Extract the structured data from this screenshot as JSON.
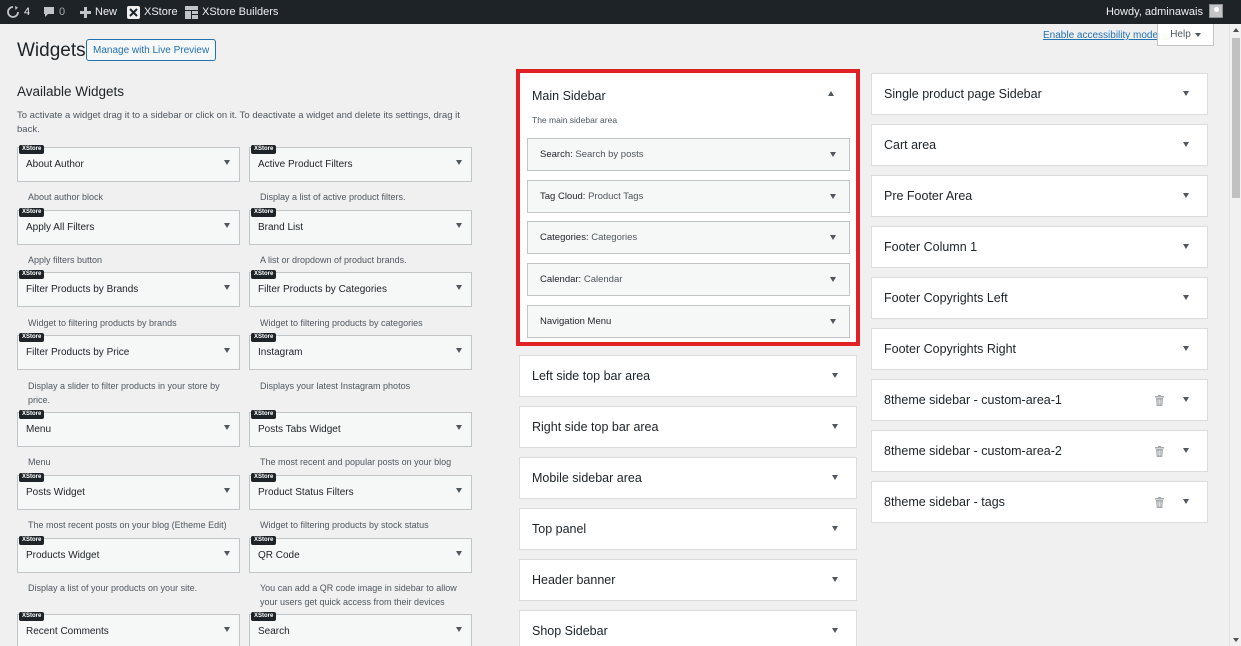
{
  "adminbar": {
    "updates_count": "4",
    "comments_count": "0",
    "new_label": "New",
    "xstore_label": "XStore",
    "builders_label": "XStore Builders",
    "howdy": "Howdy, adminawais"
  },
  "header": {
    "title": "Widgets",
    "live_preview_label": "Manage with Live Preview",
    "accessibility_link": "Enable accessibility mode",
    "help_label": "Help"
  },
  "available": {
    "title": "Available Widgets",
    "description": "To activate a widget drag it to a sidebar or click on it. To deactivate a widget and delete its settings, drag it back.",
    "badge": "XStore",
    "widgets": [
      {
        "title": "About Author",
        "desc": "About author block"
      },
      {
        "title": "Active Product Filters",
        "desc": "Display a list of active product filters."
      },
      {
        "title": "Apply All Filters",
        "desc": "Apply filters button"
      },
      {
        "title": "Brand List",
        "desc": "A list or dropdown of product brands."
      },
      {
        "title": "Filter Products by Brands",
        "desc": "Widget to filtering products by brands"
      },
      {
        "title": "Filter Products by Categories",
        "desc": "Widget to filtering products by categories"
      },
      {
        "title": "Filter Products by Price",
        "desc": "Display a slider to filter products in your store by price."
      },
      {
        "title": "Instagram",
        "desc": "Displays your latest Instagram photos"
      },
      {
        "title": "Menu",
        "desc": "Menu"
      },
      {
        "title": "Posts Tabs Widget",
        "desc": "The most recent and popular posts on your blog"
      },
      {
        "title": "Posts Widget",
        "desc": "The most recent posts on your blog (Etheme Edit)"
      },
      {
        "title": "Product Status Filters",
        "desc": "Widget to filtering products by stock status"
      },
      {
        "title": "Products Widget",
        "desc": "Display a list of your products on your site."
      },
      {
        "title": "QR Code",
        "desc": "You can add a QR code image in sidebar to allow your users get quick access from their devices"
      },
      {
        "title": "Recent Comments",
        "desc": ""
      },
      {
        "title": "Search",
        "desc": ""
      }
    ]
  },
  "main_sidebar": {
    "title": "Main Sidebar",
    "description": "The main sidebar area",
    "highlight_color": "#e02126",
    "widgets": [
      {
        "type": "Search:",
        "name": "Search by posts"
      },
      {
        "type": "Tag Cloud:",
        "name": "Product Tags"
      },
      {
        "type": "Categories:",
        "name": "Categories"
      },
      {
        "type": "Calendar:",
        "name": "Calendar"
      },
      {
        "type": "Navigation Menu",
        "name": ""
      }
    ]
  },
  "middle_sidebars": [
    "Left side top bar area",
    "Right side top bar area",
    "Mobile sidebar area",
    "Top panel",
    "Header banner",
    "Shop Sidebar"
  ],
  "right_sidebars": [
    {
      "title": "Single product page Sidebar",
      "deletable": false
    },
    {
      "title": "Cart area",
      "deletable": false
    },
    {
      "title": "Pre Footer Area",
      "deletable": false
    },
    {
      "title": "Footer Column 1",
      "deletable": false
    },
    {
      "title": "Footer Copyrights Left",
      "deletable": false
    },
    {
      "title": "Footer Copyrights Right",
      "deletable": false
    },
    {
      "title": "8theme sidebar - custom-area-1",
      "deletable": true
    },
    {
      "title": "8theme sidebar - custom-area-2",
      "deletable": true
    },
    {
      "title": "8theme sidebar - tags",
      "deletable": true
    }
  ],
  "icons": {
    "updates": "refresh-icon",
    "comments": "comment-icon",
    "new": "plus-icon",
    "xstore": "xstore-logo-icon",
    "builders": "grid-icon",
    "avatar": "user-avatar-icon",
    "trash": "trash-icon"
  }
}
